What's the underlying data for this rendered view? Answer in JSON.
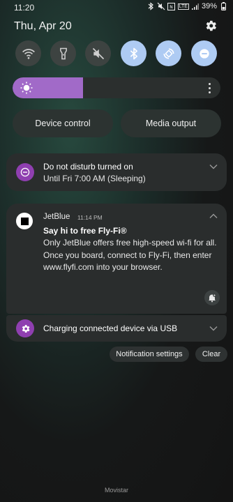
{
  "status_bar": {
    "time": "11:20",
    "battery": "39%",
    "icons": [
      "bluetooth-icon",
      "mute-icon",
      "nfc-icon",
      "lte-icon",
      "signal-icon",
      "battery-icon"
    ],
    "network": "LTE"
  },
  "header": {
    "date": "Thu, Apr 20",
    "settings_icon": "gear-icon"
  },
  "quick_settings": {
    "tiles": [
      {
        "icon": "wifi-icon",
        "on": false
      },
      {
        "icon": "flashlight-icon",
        "on": false
      },
      {
        "icon": "sound-muted-icon",
        "on": false
      },
      {
        "icon": "bluetooth-icon",
        "on": true
      },
      {
        "icon": "auto-rotate-icon",
        "on": true
      },
      {
        "icon": "do-not-disturb-icon",
        "on": true
      }
    ],
    "brightness_level": 0.34,
    "accent": "#a16ac8",
    "tile_on_color": "#aecbf3"
  },
  "controls": {
    "device_control": "Device control",
    "media_output": "Media output"
  },
  "notifications": {
    "dnd": {
      "title": "Do not disturb turned on",
      "subtitle": "Until Fri 7:00 AM (Sleeping)",
      "icon": "do-not-disturb-icon"
    },
    "jetblue": {
      "app": "JetBlue",
      "time": "11:14 PM",
      "title": "Say hi to free Fly-Fi®",
      "body": "Only JetBlue offers free high-speed wi-fi for all. Once you board, connect to Fly-Fi, then enter www.flyfi.com into your browser.",
      "icon": "jetblue-app-icon",
      "action_icon": "bell-icon"
    },
    "charging": {
      "title": "Charging connected device via USB",
      "icon": "usb-settings-icon"
    }
  },
  "actions": {
    "notification_settings": "Notification settings",
    "clear": "Clear"
  },
  "carrier": "Movistar"
}
